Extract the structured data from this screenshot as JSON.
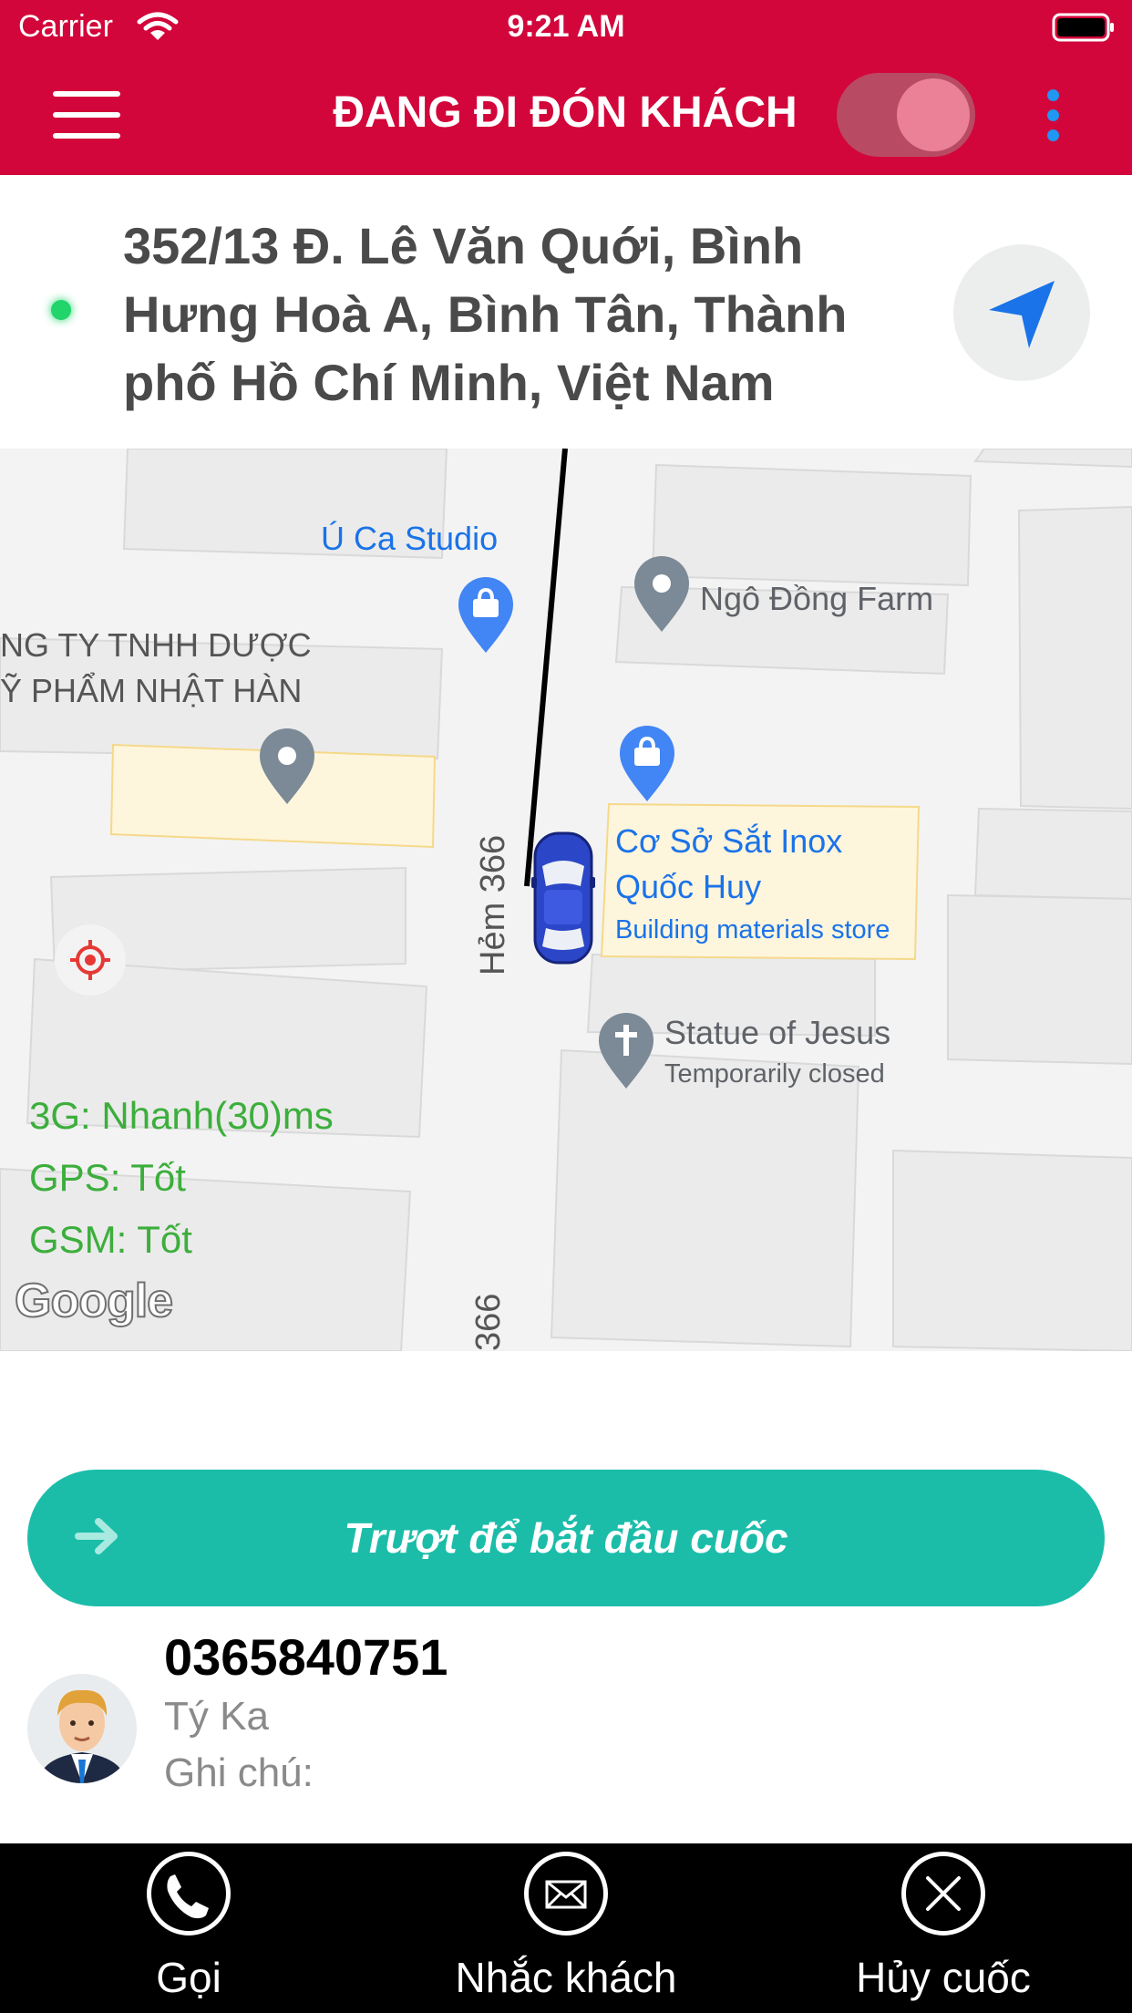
{
  "status_bar": {
    "carrier": "Carrier",
    "time": "9:21 AM"
  },
  "header": {
    "title": "ĐANG ĐI ĐÓN KHÁCH",
    "toggle_on": true
  },
  "address": {
    "text": "352/13 Đ. Lê Văn Quới, Bình Hưng Hoà A, Bình Tân, Thành phố Hồ Chí Minh, Việt Nam"
  },
  "map": {
    "pois": {
      "uca_studio": "Ú Ca Studio",
      "ngo_dong_farm": "Ngô Đồng Farm",
      "pharma_line1": "NG TY TNHH DƯỢC",
      "pharma_line2": "Ỹ PHẨM NHẬT HÀN",
      "inox_line1": "Cơ Sở Sắt Inox",
      "inox_line2": "Quốc Huy",
      "inox_category": "Building materials store",
      "statue_name": "Statue of Jesus",
      "statue_status": "Temporarily closed"
    },
    "streets": {
      "hem_366_upper": "Hẻm 366",
      "hem_366_lower": "366"
    },
    "signal": {
      "network": "3G: Nhanh(30)ms",
      "gps": "GPS: Tốt",
      "gsm": "GSM: Tốt"
    },
    "attribution": "Google"
  },
  "slide": {
    "label": "Trượt để bắt đầu cuốc"
  },
  "customer": {
    "phone": "0365840751",
    "name": "Tý Ka",
    "note": "Ghi chú:"
  },
  "bottom_bar": {
    "call": "Gọi",
    "remind": "Nhắc khách",
    "cancel": "Hủy cuốc"
  },
  "colors": {
    "brand_red": "#d2063a",
    "slide_teal": "#1bbda9",
    "signal_green": "#3cae3c",
    "poi_blue": "#1a73e8"
  },
  "icons": [
    "wifi-icon",
    "battery-icon",
    "menu-icon",
    "more-icon",
    "navigation-arrow-icon",
    "shopping-bag-pin-icon",
    "place-pin-icon",
    "church-pin-icon",
    "car-icon",
    "recenter-target-icon",
    "arrow-right-icon",
    "avatar",
    "phone-icon",
    "envelope-icon",
    "close-icon"
  ]
}
